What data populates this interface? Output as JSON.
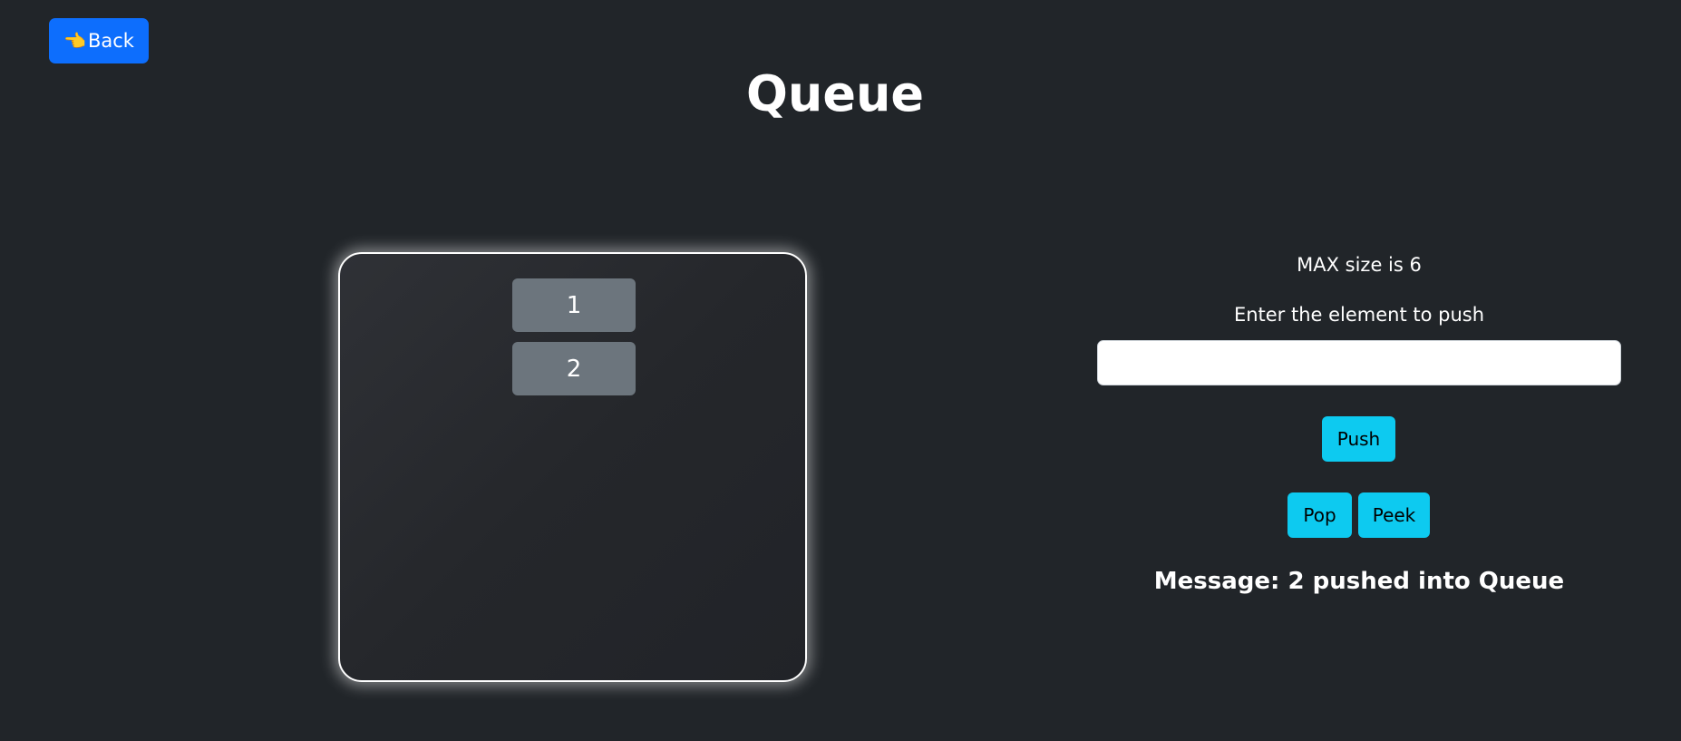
{
  "back_button": {
    "icon": "pointing-hand-icon",
    "icon_glyph": "👈",
    "label": "Back",
    "color": "#0d6efd"
  },
  "page": {
    "title": "Queue",
    "background": "#212529"
  },
  "queue": {
    "items": [
      "1",
      "2"
    ],
    "item_color": "#6c757d"
  },
  "controls": {
    "max_size_text": "MAX size is 6",
    "enter_label": "Enter the element to push",
    "input_value": "",
    "push_label": "Push",
    "pop_label": "Pop",
    "peek_label": "Peek",
    "button_color": "#0dcaf0"
  },
  "message": {
    "text": "Message: 2 pushed into Queue"
  }
}
